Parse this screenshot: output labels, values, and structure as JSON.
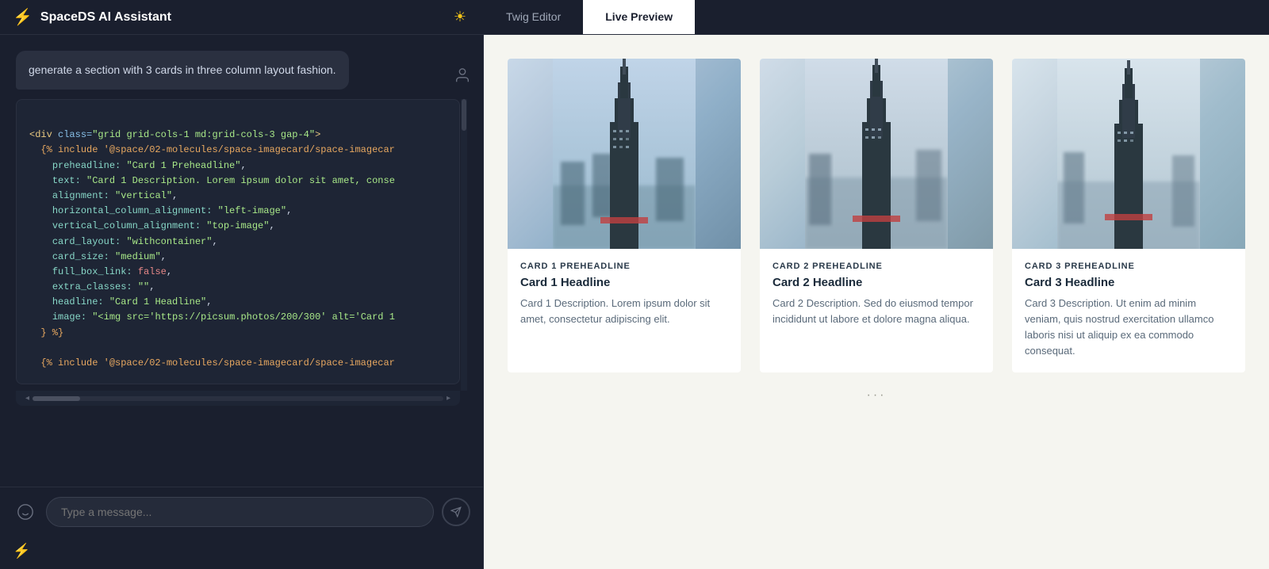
{
  "header": {
    "logo_icon": "⚡",
    "title": "SpaceDS AI Assistant",
    "sun_icon": "☀",
    "tabs": [
      {
        "id": "twig-editor",
        "label": "Twig Editor",
        "active": false
      },
      {
        "id": "live-preview",
        "label": "Live Preview",
        "active": true
      }
    ]
  },
  "chat": {
    "messages": [
      {
        "id": "msg1",
        "type": "user",
        "text": "generate a section with 3 cards in three column layout fashion."
      }
    ],
    "code_lines": [
      "<div class=\"grid grid-cols-1 md:grid-cols-3 gap-4\">",
      "  {% include '@space/02-molecules/space-imagecard/space-imagecar",
      "    preheadline: \"Card 1 Preheadline\",",
      "    text: \"Card 1 Description. Lorem ipsum dolor sit amet, conse",
      "    alignment: \"vertical\",",
      "    horizontal_column_alignment: \"left-image\",",
      "    vertical_column_alignment: \"top-image\",",
      "    card_layout: \"withcontainer\",",
      "    card_size: \"medium\",",
      "    full_box_link: false,",
      "    extra_classes: \"\",",
      "    headline: \"Card 1 Headline\",",
      "    image: \"<img src='https://picsum.photos/200/300' alt='Card 1",
      "  } %}"
    ],
    "code_line2": "  {% include '@space/02-molecules/space-imagecard/space-imagecar",
    "input_placeholder": "Type a message...",
    "emoji_icon": "🙂",
    "send_icon": "➤",
    "lightning_icon": "⚡"
  },
  "preview": {
    "cards": [
      {
        "id": "card1",
        "preheadline": "CARD 1 PREHEADLINE",
        "headline": "Card 1 Headline",
        "description": "Card 1 Description. Lorem ipsum dolor sit amet, consectetur adipiscing elit."
      },
      {
        "id": "card2",
        "preheadline": "CARD 2 PREHEADLINE",
        "headline": "Card 2 Headline",
        "description": "Card 2 Description. Sed do eiusmod tempor incididunt ut labore et dolore magna aliqua."
      },
      {
        "id": "card3",
        "preheadline": "CARD 3 PREHEADLINE",
        "headline": "Card 3 Headline",
        "description": "Card 3 Description. Ut enim ad minim veniam, quis nostrud exercitation ullamco laboris nisi ut aliquip ex ea commodo consequat."
      }
    ]
  }
}
